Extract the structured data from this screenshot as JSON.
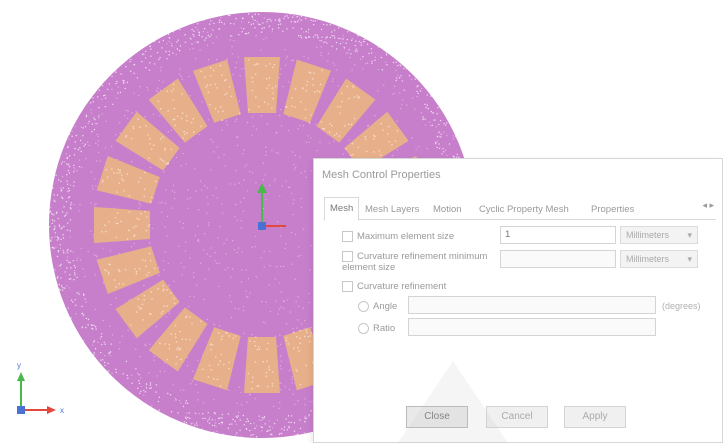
{
  "viewport": {
    "model_color": "#c87fcb",
    "slot_color": "#e7b08b",
    "mesh_dot_color": "#f4e7f5",
    "axis_colors": {
      "x": "#e2483e",
      "y": "#4bb84b",
      "z": "#4a72d4"
    },
    "triad_labels": {
      "x": "x",
      "y": "y"
    }
  },
  "dialog": {
    "title": "Mesh Control Properties",
    "tabs": [
      "Mesh",
      "Mesh Layers",
      "Motion",
      "Cyclic Property Mesh",
      "Properties"
    ],
    "tab_scroll": "◂ ▸",
    "options": {
      "max_element_size": {
        "label": "Maximum element size",
        "value": "1",
        "unit": "Millimeters"
      },
      "curvature_refinement_min": {
        "label": "Curvature refinement minimum element size",
        "unit": "Millimeters"
      },
      "curvature_refinement": {
        "label": "Curvature refinement"
      },
      "angle": {
        "label": "Angle",
        "unit": "(degrees)"
      },
      "ratio": {
        "label": "Ratio"
      }
    },
    "buttons": {
      "ok": "Close",
      "cancel": "Cancel",
      "apply": "Apply"
    }
  }
}
